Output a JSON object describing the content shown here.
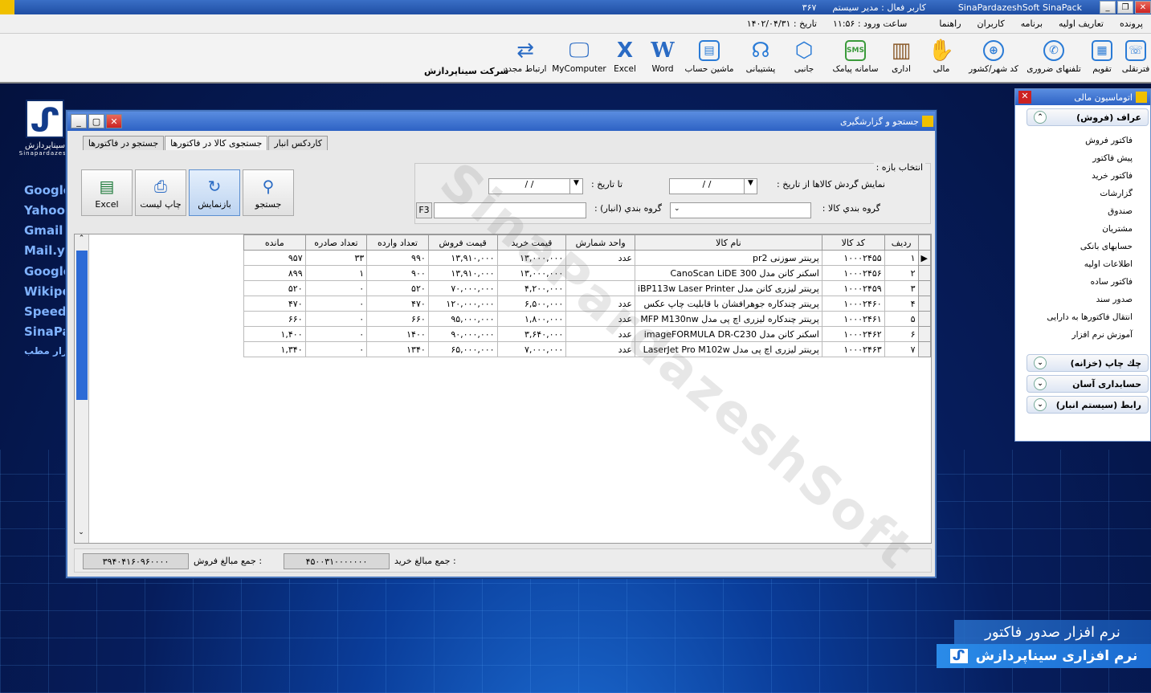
{
  "app": {
    "title": "SinaPardazeshSoft SinaPack",
    "active_user": "کاربر فعال : مدیر سیستم",
    "code": "۳۶۷",
    "date_label": "تاریخ : ۱۴۰۲/۰۴/۳۱",
    "login_time": "ساعت ورود : ۱۱:۵۶",
    "company": "شرکت سیناپردازش"
  },
  "menu": [
    "پرونده",
    "تعاریف اولیه",
    "برنامه",
    "کاربران",
    "راهنما"
  ],
  "toolbar": [
    {
      "label": "فترنقلی",
      "icon": "phone-icon"
    },
    {
      "label": "تقویم",
      "icon": "calendar-icon"
    },
    {
      "label": "تلفنهای ضروری",
      "icon": "phone-book-icon"
    },
    {
      "label": "کد شهر/کشور",
      "icon": "globe-icon"
    },
    {
      "label": "مالی",
      "icon": "money-hand-icon"
    },
    {
      "label": "اداری",
      "icon": "building-icon"
    },
    {
      "label": "سامانه پیامک",
      "icon": "sms-icon"
    },
    {
      "label": "جانبی",
      "icon": "box-icon"
    },
    {
      "label": "پشتیبانی",
      "icon": "support-icon"
    },
    {
      "label": "ماشین حساب",
      "icon": "calculator-icon"
    },
    {
      "label": "Word",
      "icon": "word-icon"
    },
    {
      "label": "Excel",
      "icon": "excel-icon"
    },
    {
      "label": "MyComputer",
      "icon": "computer-icon"
    },
    {
      "label": "ارتباط مجدد",
      "icon": "reconnect-icon"
    }
  ],
  "logo": {
    "name": "سیناپردازش",
    "sub": "Sinapardazesh"
  },
  "side_links": [
    "Google",
    "Yahoo",
    "Gmail",
    "Mail.ya",
    "Google",
    "Wikipe",
    "Speedt",
    "SinaPa",
    "فزار مطب"
  ],
  "window": {
    "title": "جستجو و گزارشگیری",
    "tabs": [
      "کاردکس انبار",
      "جستجوی کالا در فاکتورها",
      "جستجو در فاکتورها"
    ],
    "filter": {
      "group_label": "انتخاب بازه :",
      "from_label": "نمایش گردش کالاها از تاریخ :",
      "to_label": "تا تاریخ :",
      "date_placeholder": "/ /",
      "cat_label": "گروه بندي کالا :",
      "warehouse_label": "گروه بندي (انبار) :",
      "f3": "F3"
    },
    "buttons": {
      "search": "جستجو",
      "refresh": "بازنمایش",
      "print": "چاپ لیست",
      "excel": "Excel"
    },
    "columns": [
      "ردیف",
      "کد کالا",
      "نام کالا",
      "واحد شمارش",
      "قیمت خرید",
      "قیمت فروش",
      "تعداد وارده",
      "تعداد صادره",
      "مانده"
    ],
    "rows": [
      [
        "۱",
        "۱۰۰۰۲۴۵۵",
        "پرینتر سوزنی pr2",
        "عدد",
        "۱۳,۰۰۰,۰۰۰",
        "۱۳,۹۱۰,۰۰۰",
        "۹۹۰",
        "۳۳",
        "۹۵۷"
      ],
      [
        "۲",
        "۱۰۰۰۲۴۵۶",
        "اسکنر کانن مدل CanoScan LiDE 300",
        "",
        "۱۳,۰۰۰,۰۰۰",
        "۱۳,۹۱۰,۰۰۰",
        "۹۰۰",
        "۱",
        "۸۹۹"
      ],
      [
        "۳",
        "۱۰۰۰۲۴۵۹",
        "پرینتر لیزری کانن مدل iBP113w Laser Printer",
        "",
        "۴,۲۰۰,۰۰۰",
        "۷۰,۰۰۰,۰۰۰",
        "۵۲۰",
        "۰",
        "۵۲۰"
      ],
      [
        "۴",
        "۱۰۰۰۲۴۶۰",
        "پرینتر چندکاره جوهرافشان با قابلیت چاپ عکس",
        "عدد",
        "۶,۵۰۰,۰۰۰",
        "۱۲۰,۰۰۰,۰۰۰",
        "۴۷۰",
        "۰",
        "۴۷۰"
      ],
      [
        "۵",
        "۱۰۰۰۲۴۶۱",
        "پرینتر چندکاره لیزری اچ پی مدل MFP M130nw",
        "عدد",
        "۱,۸۰۰,۰۰۰",
        "۹۵,۰۰۰,۰۰۰",
        "۶۶۰",
        "۰",
        "۶۶۰"
      ],
      [
        "۶",
        "۱۰۰۰۲۴۶۲",
        "اسکنر کانن مدل imageFORMULA DR-C230",
        "عدد",
        "۳,۶۴۰,۰۰۰",
        "۹۰,۰۰۰,۰۰۰",
        "۱۴۰۰",
        "۰",
        "۱,۴۰۰"
      ],
      [
        "۷",
        "۱۰۰۰۲۴۶۳",
        "پرینتر لیزری اچ پی مدل LaserJet Pro M102w",
        "عدد",
        "۷,۰۰۰,۰۰۰",
        "۶۵,۰۰۰,۰۰۰",
        "۱۳۴۰",
        "۰",
        "۱,۳۴۰"
      ]
    ],
    "footer": {
      "buy_label": "جمع مبالغ خرید :",
      "buy_total": "۴۵۰۰۳۱۰۰۰۰۰۰۰",
      "sell_label": "جمع مبالغ فروش :",
      "sell_total": "۳۹۴۰۴۱۶۰۹۶۰۰۰۰"
    }
  },
  "right_panel": {
    "title": "اتوماسیون مالی",
    "sections": [
      {
        "label": "عراف (فروش)",
        "items": [
          "فاکتور فروش",
          "پیش فاکتور",
          "فاکتور خرید",
          "گزارشات",
          "صندوق",
          "مشتریان",
          "حسابهای بانکی",
          "اطلاعات اولیه",
          "فاکتور ساده",
          "صدور سند",
          "انتقال فاکتورها به دارایی",
          "آموزش نرم افزار"
        ]
      },
      {
        "label": "چك چاپ (خزانه)"
      },
      {
        "label": "حسابداری آسان"
      },
      {
        "label": "رابط (سیستم انبار)"
      }
    ]
  },
  "banners": {
    "line1": "نرم افزار صدور فاکتور",
    "line2": "نرم افزاری سیناپردازش"
  },
  "watermark": "SinaPardazeshSoft"
}
